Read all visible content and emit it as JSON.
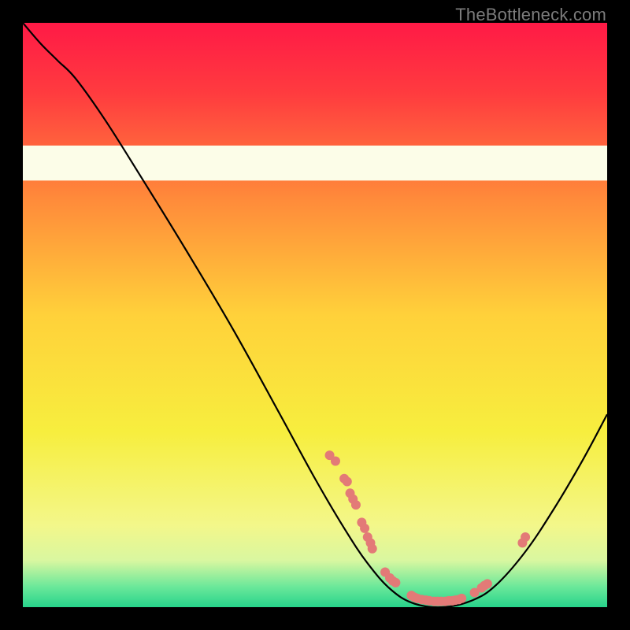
{
  "watermark": "TheBottleneck.com",
  "chart_data": {
    "type": "line",
    "title": "",
    "xlabel": "",
    "ylabel": "",
    "xlim": [
      0,
      100
    ],
    "ylim": [
      0,
      100
    ],
    "background_gradient": {
      "stops": [
        {
          "offset": 0.0,
          "color": "#ff1a46"
        },
        {
          "offset": 0.12,
          "color": "#ff3b3f"
        },
        {
          "offset": 0.3,
          "color": "#ff8a3a"
        },
        {
          "offset": 0.5,
          "color": "#ffd13a"
        },
        {
          "offset": 0.7,
          "color": "#f7ee3e"
        },
        {
          "offset": 0.86,
          "color": "#f3f78a"
        },
        {
          "offset": 0.92,
          "color": "#d9f7a0"
        },
        {
          "offset": 0.965,
          "color": "#6be89a"
        },
        {
          "offset": 1.0,
          "color": "#27d38b"
        }
      ]
    },
    "white_band": {
      "y_from": 73,
      "y_to": 79
    },
    "series": [
      {
        "name": "bottleneck-curve",
        "type": "line",
        "stroke": "#000000",
        "stroke_width": 2.2,
        "points": [
          {
            "x": 0.0,
            "y": 100.0
          },
          {
            "x": 3.0,
            "y": 96.5
          },
          {
            "x": 6.0,
            "y": 93.5
          },
          {
            "x": 9.0,
            "y": 90.5
          },
          {
            "x": 14.0,
            "y": 83.5
          },
          {
            "x": 20.0,
            "y": 74.0
          },
          {
            "x": 28.0,
            "y": 61.0
          },
          {
            "x": 36.0,
            "y": 47.5
          },
          {
            "x": 44.0,
            "y": 33.0
          },
          {
            "x": 50.0,
            "y": 22.0
          },
          {
            "x": 55.0,
            "y": 13.5
          },
          {
            "x": 59.0,
            "y": 7.5
          },
          {
            "x": 63.0,
            "y": 3.0
          },
          {
            "x": 67.0,
            "y": 0.6
          },
          {
            "x": 72.0,
            "y": 0.0
          },
          {
            "x": 77.0,
            "y": 1.2
          },
          {
            "x": 81.0,
            "y": 3.8
          },
          {
            "x": 86.0,
            "y": 9.5
          },
          {
            "x": 91.0,
            "y": 17.0
          },
          {
            "x": 96.0,
            "y": 25.5
          },
          {
            "x": 100.0,
            "y": 33.0
          }
        ]
      },
      {
        "name": "data-markers",
        "type": "scatter",
        "fill": "#e37a77",
        "radius": 6,
        "points": [
          {
            "x": 52.5,
            "y": 26.0
          },
          {
            "x": 53.5,
            "y": 25.0
          },
          {
            "x": 55.0,
            "y": 22.0
          },
          {
            "x": 55.5,
            "y": 21.5
          },
          {
            "x": 56.0,
            "y": 19.5
          },
          {
            "x": 56.5,
            "y": 18.5
          },
          {
            "x": 57.0,
            "y": 17.5
          },
          {
            "x": 58.0,
            "y": 14.5
          },
          {
            "x": 58.5,
            "y": 13.5
          },
          {
            "x": 59.0,
            "y": 12.0
          },
          {
            "x": 59.5,
            "y": 11.0
          },
          {
            "x": 59.8,
            "y": 10.0
          },
          {
            "x": 62.0,
            "y": 6.0
          },
          {
            "x": 62.8,
            "y": 5.0
          },
          {
            "x": 63.3,
            "y": 4.5
          },
          {
            "x": 63.8,
            "y": 4.2
          },
          {
            "x": 66.5,
            "y": 2.0
          },
          {
            "x": 67.0,
            "y": 1.7
          },
          {
            "x": 67.5,
            "y": 1.5
          },
          {
            "x": 68.3,
            "y": 1.3
          },
          {
            "x": 69.0,
            "y": 1.2
          },
          {
            "x": 69.6,
            "y": 1.1
          },
          {
            "x": 70.4,
            "y": 1.0
          },
          {
            "x": 71.0,
            "y": 1.0
          },
          {
            "x": 71.6,
            "y": 1.0
          },
          {
            "x": 72.3,
            "y": 1.0
          },
          {
            "x": 72.9,
            "y": 1.1
          },
          {
            "x": 73.5,
            "y": 1.1
          },
          {
            "x": 74.0,
            "y": 1.2
          },
          {
            "x": 74.6,
            "y": 1.3
          },
          {
            "x": 75.1,
            "y": 1.5
          },
          {
            "x": 77.3,
            "y": 2.5
          },
          {
            "x": 78.5,
            "y": 3.3
          },
          {
            "x": 79.0,
            "y": 3.7
          },
          {
            "x": 79.5,
            "y": 4.0
          },
          {
            "x": 85.5,
            "y": 11.0
          },
          {
            "x": 86.0,
            "y": 12.0
          }
        ]
      }
    ]
  }
}
